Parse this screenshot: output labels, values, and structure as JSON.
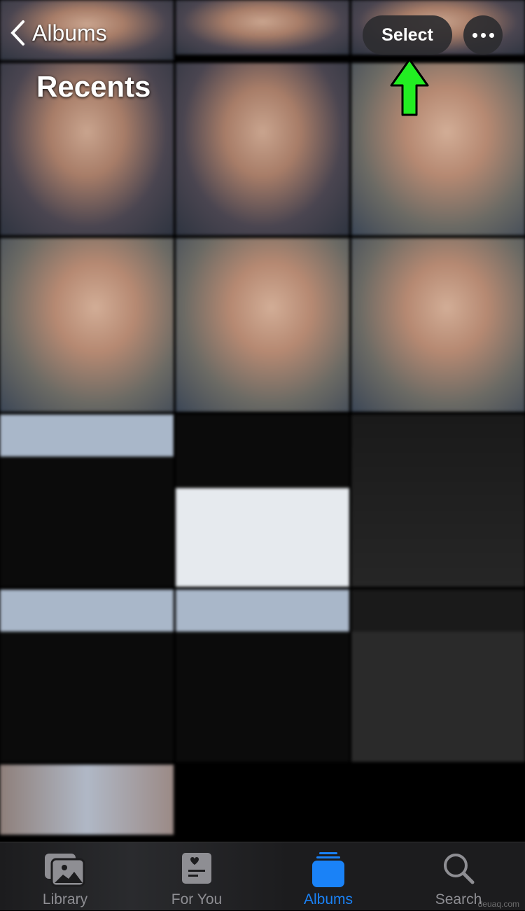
{
  "header": {
    "back_label": "Albums",
    "title": "Recents",
    "select_label": "Select",
    "more_icon": "ellipsis-icon"
  },
  "annotation": {
    "arrow_color": "#22ee22",
    "points_to": "Select"
  },
  "tabs": [
    {
      "label": "Library",
      "icon": "photos-icon",
      "active": false
    },
    {
      "label": "For You",
      "icon": "for-you-icon",
      "active": false
    },
    {
      "label": "Albums",
      "icon": "albums-icon",
      "active": true
    },
    {
      "label": "Search",
      "icon": "search-icon",
      "active": false
    }
  ],
  "colors": {
    "accent": "#1a82f7",
    "inactive": "#8e8e93"
  },
  "watermark": "deuaq.com"
}
